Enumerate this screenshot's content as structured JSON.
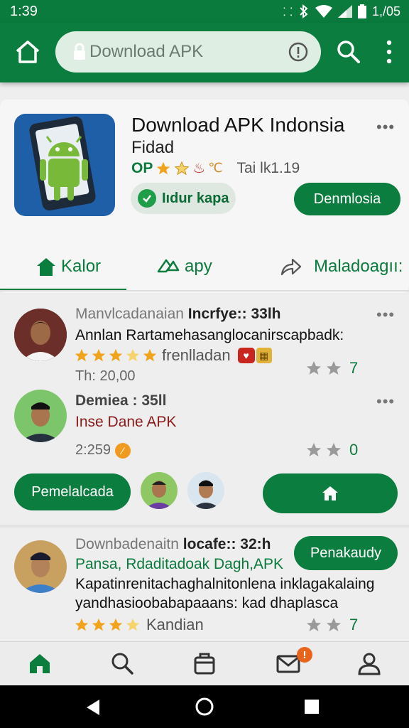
{
  "status_bar": {
    "time": "1:39",
    "right_text": "1,/05"
  },
  "app_bar": {
    "url": "Download APK"
  },
  "app_card": {
    "title": "Download APK Indonsia",
    "subtitle": "Fidad",
    "meta_prefix": "OP",
    "review_text": "Tai lk1.19",
    "install_chip_label": "Iıdur kapa",
    "download_button_label": "Denmlosia"
  },
  "tabs": [
    {
      "label": "Kalor"
    },
    {
      "label": "apy"
    },
    {
      "label": "Maladoagıı:"
    }
  ],
  "posts": [
    {
      "meta": "Manvlcadanaian",
      "meta_bold": "Incrfye:: 33lh",
      "text": "Annlan Rartamehasanglocanirscapbadk:",
      "rating_label": "frenlladan",
      "date": "Th: 20,00",
      "votes": "7"
    },
    {
      "meta_bold": "Demiea : 35ll",
      "text": "Inse Dane APK",
      "date": "2:259",
      "votes": "0"
    },
    {
      "meta": "Downbadenaitn",
      "meta_bold": "locafe:: 32:h",
      "headline": "Pansa, Rdaditadoak Dagh,APK",
      "text_line1": "Kapatinrenitachaghalnitonlena inklagakalaing",
      "text_line2": "yandhasioobabapaaans: kad dhaplasca",
      "rating_label": "Kandian",
      "votes": "7"
    }
  ],
  "actions": {
    "pill_label": "Pemelalcada",
    "follow_label": "Penakaudy"
  },
  "bottom_nav": {
    "notification_count": "!"
  },
  "colors": {
    "primary": "#0b7d3e",
    "accent_star": "#f0a31b",
    "badge": "#e8641b"
  }
}
